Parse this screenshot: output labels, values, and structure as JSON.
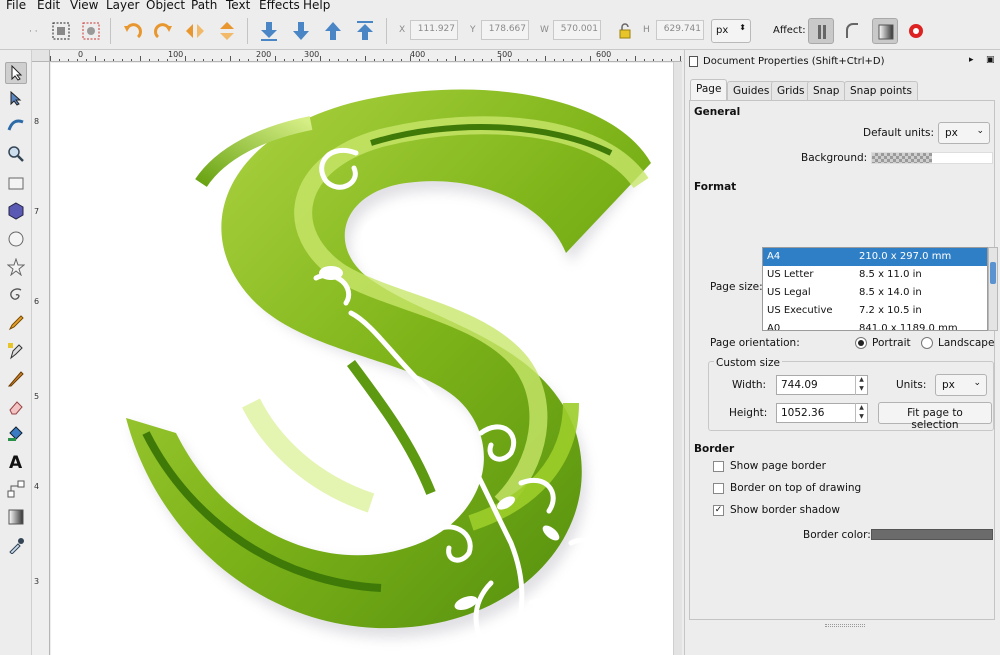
{
  "menu": {
    "items": [
      "File",
      "Edit",
      "View",
      "Layer",
      "Object",
      "Path",
      "Text",
      "Effects",
      "Help"
    ]
  },
  "toolbar": {
    "x_label": "X",
    "x_value": "111.927",
    "y_label": "Y",
    "y_value": "178.667",
    "w_label": "W",
    "w_value": "570.001",
    "h_label": "H",
    "h_value": "629.741",
    "unit": "px",
    "affect_label": "Affect:"
  },
  "ruler": {
    "h_ticks": [
      "0",
      "100",
      "200",
      "300",
      "400",
      "500",
      "600"
    ],
    "v_ticks": [
      "8",
      "7",
      "6",
      "5",
      "4",
      "3"
    ]
  },
  "panel": {
    "title": "Document Properties (Shift+Ctrl+D)",
    "tabs": [
      "Page",
      "Guides",
      "Grids",
      "Snap",
      "Snap points"
    ],
    "general_heading": "General",
    "default_units_label": "Default units:",
    "default_units_value": "px",
    "background_label": "Background:",
    "format_heading": "Format",
    "page_size_label": "Page size:",
    "page_sizes": [
      {
        "name": "A4",
        "size": "210.0 x 297.0 mm"
      },
      {
        "name": "US Letter",
        "size": "8.5 x 11.0 in"
      },
      {
        "name": "US Legal",
        "size": "8.5 x 14.0 in"
      },
      {
        "name": "US Executive",
        "size": "7.2 x 10.5 in"
      },
      {
        "name": "A0",
        "size": "841.0 x 1189.0 mm"
      }
    ],
    "orientation_label": "Page orientation:",
    "portrait_label": "Portrait",
    "landscape_label": "Landscape",
    "custom_size_label": "Custom size",
    "width_label": "Width:",
    "width_value": "744.09",
    "height_label": "Height:",
    "height_value": "1052.36",
    "units_label": "Units:",
    "units_value": "px",
    "fit_button": "Fit page to selection",
    "border_heading": "Border",
    "show_page_border": "Show page border",
    "border_on_top": "Border on top of drawing",
    "show_border_shadow": "Show border shadow",
    "border_color_label": "Border color:",
    "selection_color": "#2f7fc6",
    "border_color": "#6b6b6b"
  }
}
